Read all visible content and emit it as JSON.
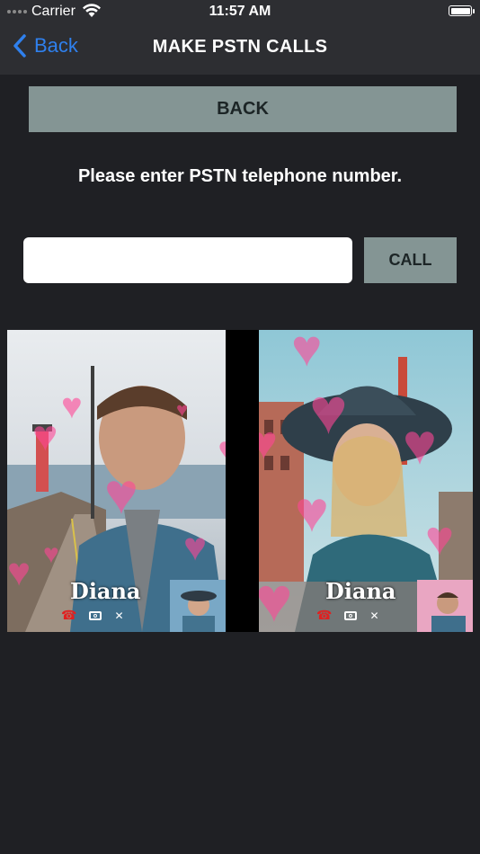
{
  "status": {
    "carrier": "Carrier",
    "time": "11:57 AM"
  },
  "nav": {
    "back_label": "Back",
    "title": "MAKE PSTN CALLS"
  },
  "back_button": "BACK",
  "prompt": "Please enter PSTN telephone number.",
  "phone_input": {
    "value": "",
    "placeholder": ""
  },
  "call_button": "CALL",
  "preview": {
    "left_caller_name": "Diana",
    "right_caller_name": "Diana",
    "icons": [
      "end-call-icon",
      "camera-icon",
      "minimize-icon"
    ]
  }
}
